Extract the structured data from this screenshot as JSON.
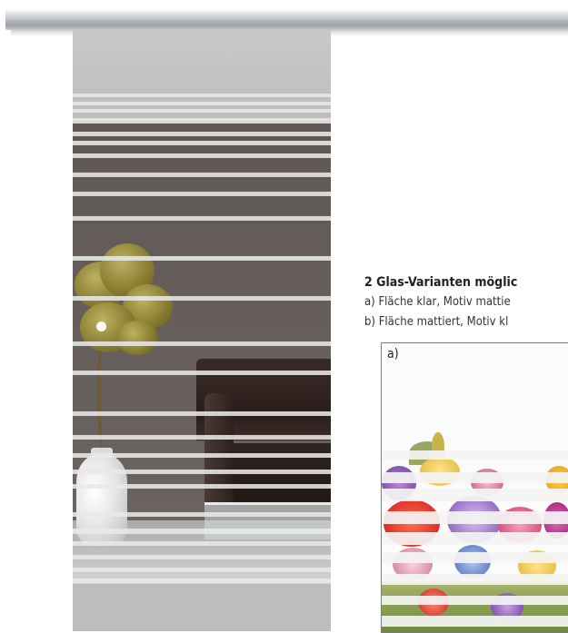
{
  "rail": {
    "icon": "sliding-door-rail"
  },
  "door": {
    "image": "sliding-glass-door-striped",
    "accent": "#ececec"
  },
  "info": {
    "heading": "2 Glas-Varianten möglic",
    "option_a": "a) Fläche klar, Motiv mattie",
    "option_b": "b) Fläche mattiert, Motiv kl"
  },
  "sample": {
    "label": "a)",
    "image": "flower-motif-glass-sample"
  }
}
